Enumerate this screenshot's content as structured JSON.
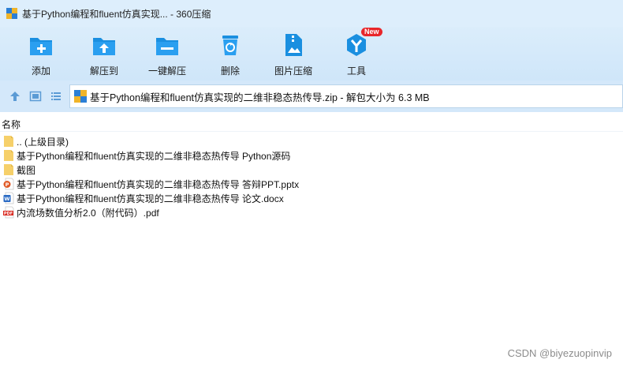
{
  "window": {
    "title": "基于Python编程和fluent仿真实现... - 360压缩"
  },
  "toolbar": {
    "items": [
      {
        "label": "添加",
        "icon": "add-folder-icon"
      },
      {
        "label": "解压到",
        "icon": "extract-to-icon"
      },
      {
        "label": "一键解压",
        "icon": "one-click-extract-icon"
      },
      {
        "label": "删除",
        "icon": "delete-trash-icon"
      },
      {
        "label": "图片压缩",
        "icon": "image-compress-icon"
      },
      {
        "label": "工具",
        "icon": "tools-icon",
        "badge": "New"
      }
    ]
  },
  "addressbar": {
    "path": "基于Python编程和fluent仿真实现的二维非稳态热传导.zip - 解包大小为 6.3 MB"
  },
  "filelist": {
    "column_name": "名称",
    "items": [
      {
        "name": ".. (上级目录)",
        "icon": "folder-icon"
      },
      {
        "name": "基于Python编程和fluent仿真实现的二维非稳态热传导 Python源码",
        "icon": "folder-icon"
      },
      {
        "name": "截图",
        "icon": "folder-icon"
      },
      {
        "name": "基于Python编程和fluent仿真实现的二维非稳态热传导 答辩PPT.pptx",
        "icon": "pptx-file-icon"
      },
      {
        "name": "基于Python编程和fluent仿真实现的二维非稳态热传导 论文.docx",
        "icon": "docx-file-icon"
      },
      {
        "name": "内流场数值分析2.0（附代码）.pdf",
        "icon": "pdf-file-icon"
      }
    ]
  },
  "watermark": "CSDN @biyezuopinvip",
  "colors": {
    "accent": "#1a8fe0",
    "toolbar_bg": "#d4e8fa",
    "badge": "#e8262a",
    "folder": "#f6d06a"
  }
}
